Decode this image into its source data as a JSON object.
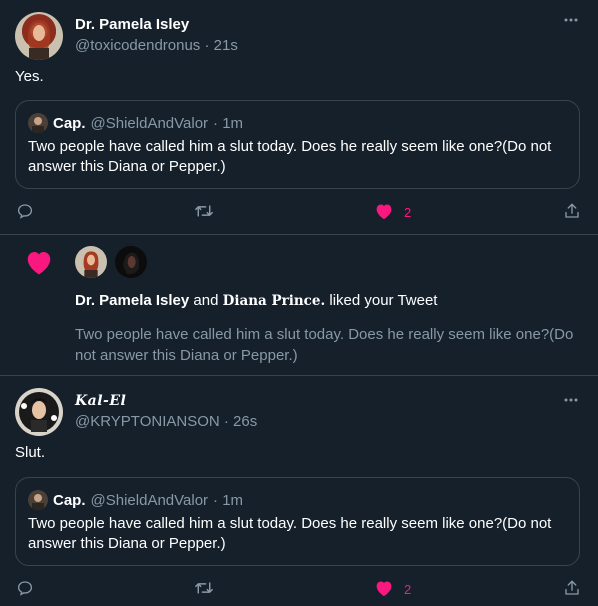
{
  "tweet1": {
    "author_name": "Dr. Pamela Isley",
    "author_handle": "@toxicodendronus",
    "time": "· 21s",
    "text": "Yes.",
    "quote": {
      "author_name": "Cap.",
      "author_handle": "@ShieldAndValor",
      "time": "· 1m",
      "text": "Two people have called him a slut today. Does he really seem like one?(Do not answer this Diana or Pepper.)"
    },
    "like_count": "2"
  },
  "notification": {
    "name1": "Dr. Pamela Isley",
    "connector": "and",
    "name2": "Diana Prince.",
    "action": "liked your Tweet",
    "tweet_text": "Two people have called him a slut today. Does he really seem like one?(Do not answer this Diana or Pepper.)"
  },
  "tweet2": {
    "author_name": "Kal-El",
    "author_handle": "@KRYPTONIANSON",
    "time": "· 26s",
    "text": "Slut.",
    "quote": {
      "author_name": "Cap.",
      "author_handle": "@ShieldAndValor",
      "time": "· 1m",
      "text": "Two people have called him a slut today. Does he really seem like one?(Do not answer this Diana or Pepper.)"
    },
    "like_count": "2"
  },
  "colors": {
    "background": "#15202b",
    "border": "#38444d",
    "muted": "#8899a6",
    "like_pink": "#f91880"
  },
  "icons": {
    "more": "more-horizontal-icon",
    "reply": "reply-icon",
    "retweet": "retweet-icon",
    "like": "heart-filled-icon",
    "share": "share-icon"
  }
}
